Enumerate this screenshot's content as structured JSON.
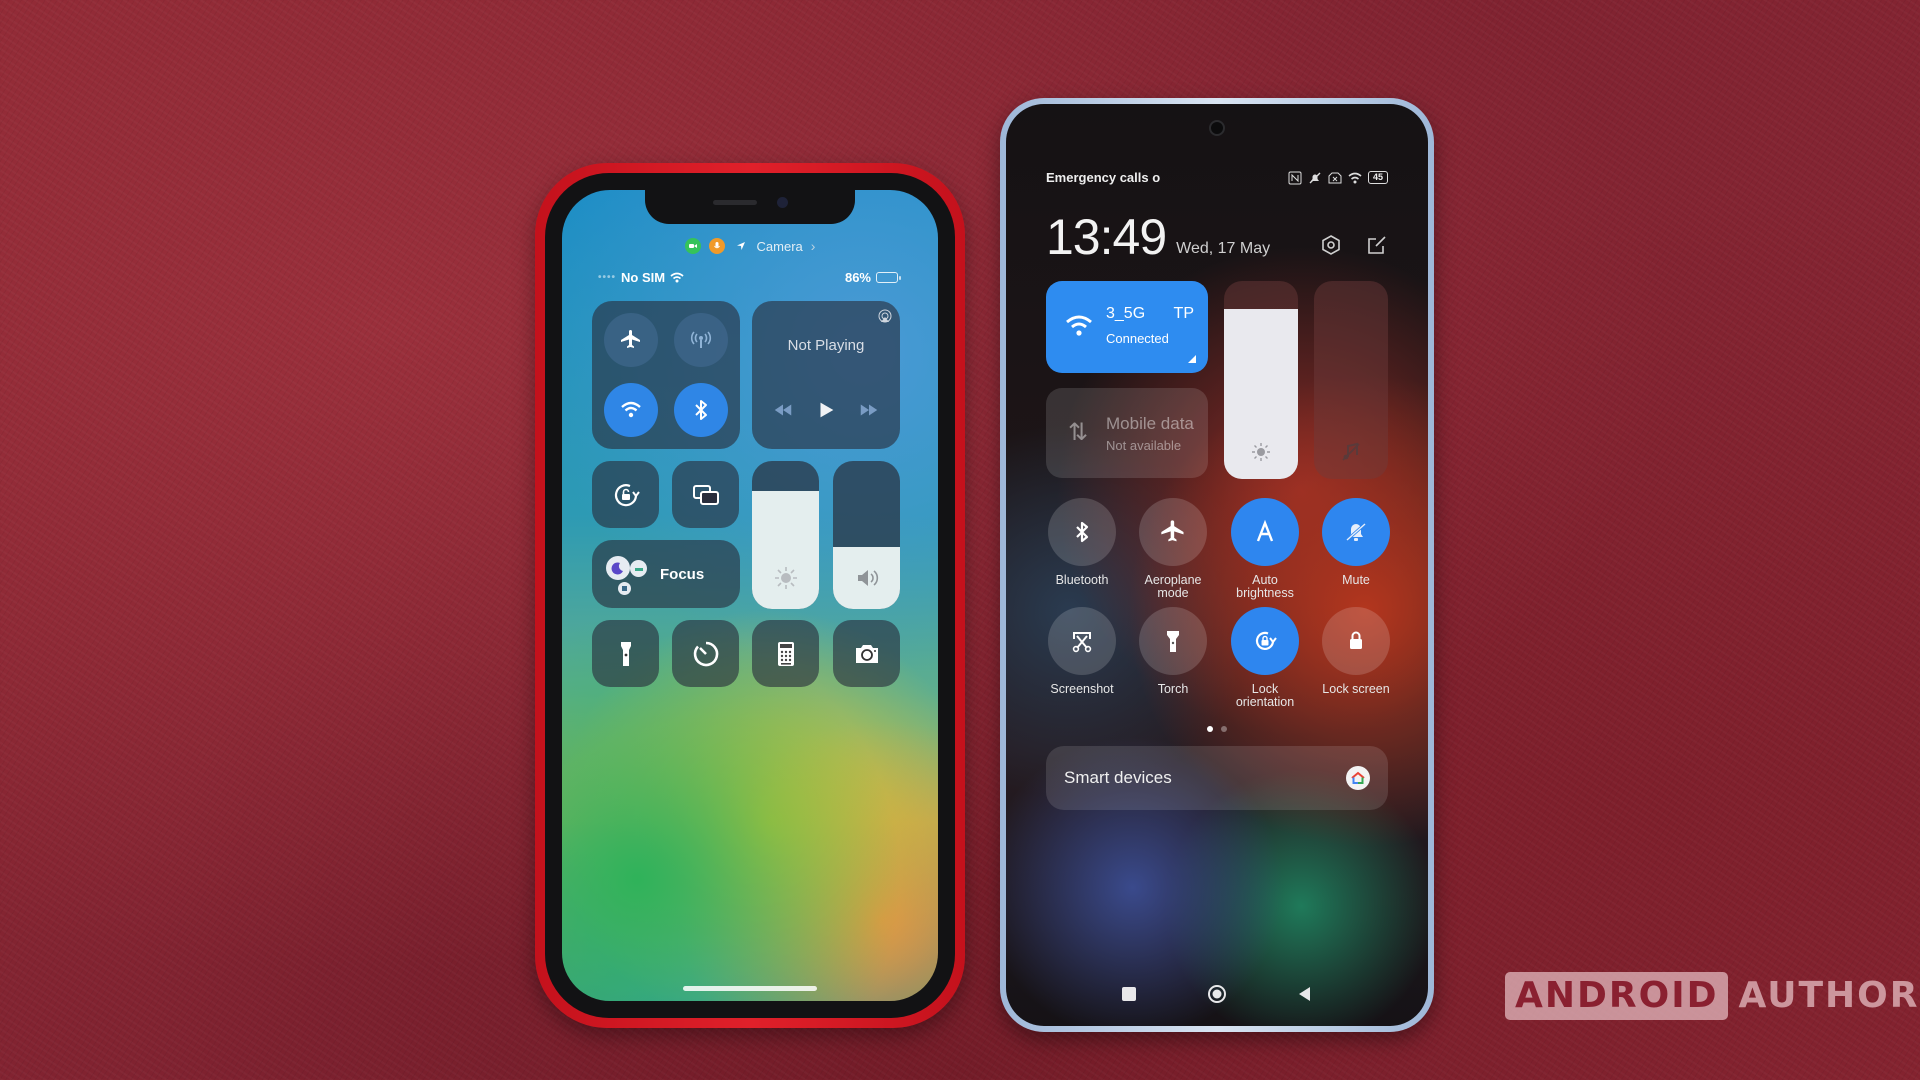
{
  "iphone": {
    "privacy_indicator": {
      "active_app": "Camera",
      "icons": [
        "video-camera-icon",
        "microphone-icon",
        "location-arrow-icon"
      ],
      "colors": {
        "camera": "#35c35a",
        "microphone": "#f09a2a",
        "location": "#2f86e6"
      }
    },
    "status_bar": {
      "carrier": "No SIM",
      "battery_percent": "86%",
      "battery_level": 0.86
    },
    "control_center": {
      "connectivity": [
        {
          "name": "Airplane Mode",
          "icon": "airplane-icon",
          "on": false
        },
        {
          "name": "Cellular Data",
          "icon": "antenna-icon",
          "on": false
        },
        {
          "name": "Wi-Fi",
          "icon": "wifi-icon",
          "on": true
        },
        {
          "name": "Bluetooth",
          "icon": "bluetooth-icon",
          "on": true
        }
      ],
      "media": {
        "title": "Not Playing"
      },
      "focus_label": "Focus",
      "brightness_level": 0.8,
      "volume_level": 0.42,
      "shortcuts": [
        {
          "name": "Flashlight",
          "icon": "flashlight-icon"
        },
        {
          "name": "Timer",
          "icon": "timer-icon"
        },
        {
          "name": "Calculator",
          "icon": "calculator-icon"
        },
        {
          "name": "Camera",
          "icon": "camera-icon"
        }
      ]
    }
  },
  "redmi": {
    "status_bar": {
      "left_text": "Emergency calls o",
      "battery": "45",
      "icons": [
        "nfc-icon",
        "notifications-off-icon",
        "no-sim-icon",
        "wifi-icon",
        "battery-icon"
      ]
    },
    "clock": {
      "time": "13:49",
      "date": "Wed, 17 May"
    },
    "wifi_tile": {
      "ssid": "3_5G",
      "ssid_right": "TP",
      "status": "Connected"
    },
    "mobile_tile": {
      "title": "Mobile data",
      "status": "Not available"
    },
    "brightness_level": 0.86,
    "volume_level": 0.0,
    "toggles": [
      {
        "label": "Bluetooth",
        "icon": "bluetooth-icon",
        "on": false
      },
      {
        "label": "Aeroplane mode",
        "icon": "airplane-icon",
        "on": false
      },
      {
        "label": "Auto brightness",
        "icon": "auto-brightness-icon",
        "on": true
      },
      {
        "label": "Mute",
        "icon": "bell-off-icon",
        "on": true
      },
      {
        "label": "Screenshot",
        "icon": "screenshot-icon",
        "on": false
      },
      {
        "label": "Torch",
        "icon": "flashlight-icon",
        "on": false
      },
      {
        "label": "Lock orientation",
        "icon": "rotation-lock-icon",
        "on": true
      },
      {
        "label": "Lock screen",
        "icon": "lock-icon",
        "on": false
      }
    ],
    "pager": {
      "pages": 2,
      "current": 1
    },
    "smart_devices_label": "Smart devices",
    "nav": [
      "recents-icon",
      "home-icon",
      "back-icon"
    ]
  },
  "watermark": {
    "boxed": "ANDROID",
    "text": "AUTHORITY"
  }
}
